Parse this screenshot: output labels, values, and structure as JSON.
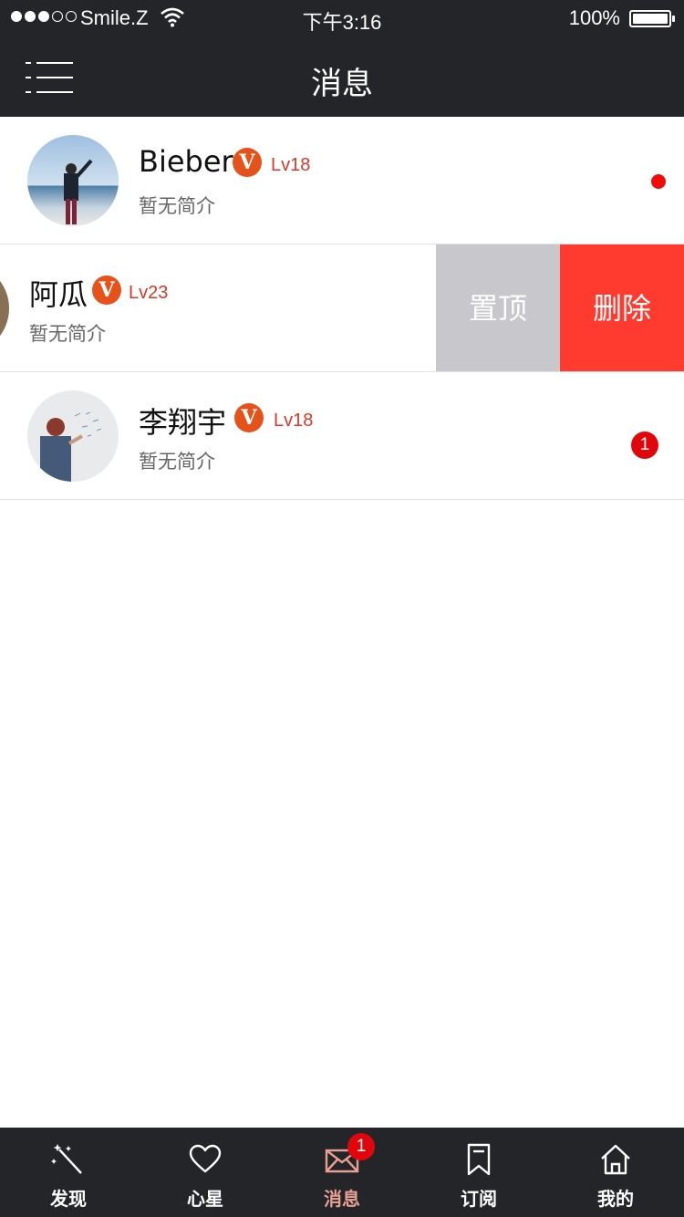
{
  "status_bar": {
    "carrier": "Smile.Z",
    "time": "下午3:16",
    "battery": "100%"
  },
  "nav": {
    "title": "消息"
  },
  "messages": [
    {
      "name": "Bieber",
      "verified": "V",
      "level": "Lv18",
      "intro": "暂无简介",
      "unread": "dot"
    },
    {
      "name": "阿瓜",
      "verified": "V",
      "level": "Lv23",
      "intro": "暂无简介"
    },
    {
      "name": "李翔宇",
      "verified": "V",
      "level": "Lv18",
      "intro": "暂无简介",
      "unread_count": "1"
    }
  ],
  "swipe_actions": {
    "pin_label": "置顶",
    "delete_label": "删除"
  },
  "tabbar": {
    "items": [
      {
        "label": "发现",
        "icon": "magic-wand-icon"
      },
      {
        "label": "心星",
        "icon": "heart-icon"
      },
      {
        "label": "消息",
        "icon": "mail-icon",
        "badge": "1",
        "active": true
      },
      {
        "label": "订阅",
        "icon": "bookmark-icon"
      },
      {
        "label": "我的",
        "icon": "home-icon"
      }
    ]
  },
  "colors": {
    "bar_bg": "#242528",
    "accent": "#e5521a",
    "delete": "#ff3b30",
    "pin": "#c7c7cc",
    "badge": "#e0060c"
  }
}
